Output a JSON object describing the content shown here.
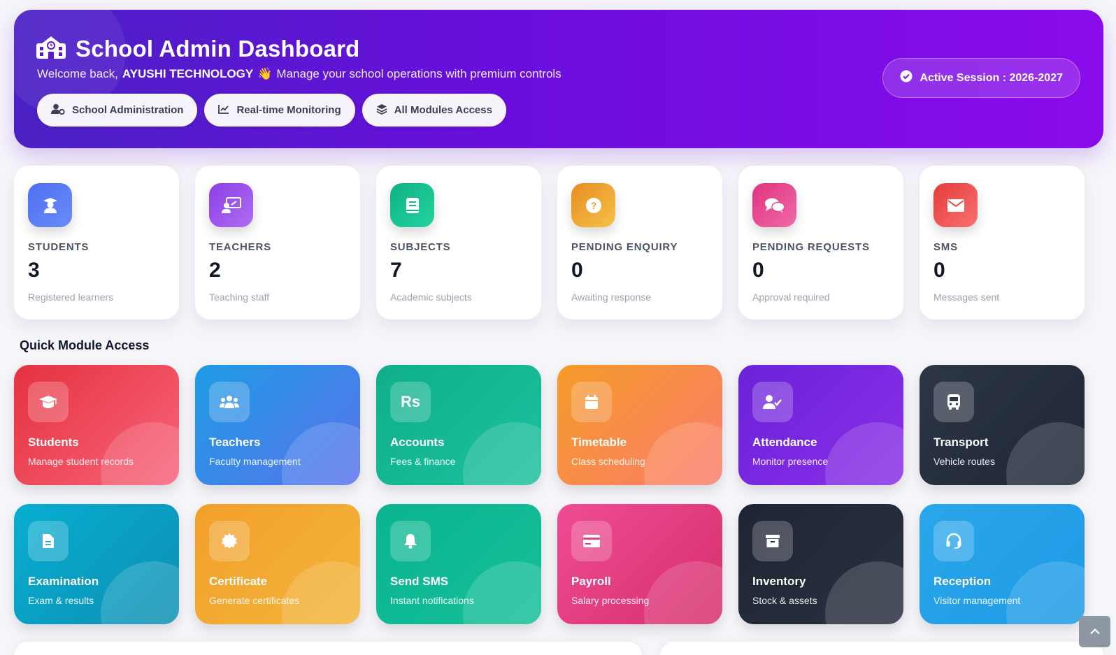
{
  "header": {
    "title": "School Admin Dashboard",
    "welcome_prefix": "Welcome back,",
    "user_name": "AYUSHI TECHNOLOGY",
    "wave_emoji": "👋",
    "welcome_suffix": "Manage your school operations with premium controls",
    "pills": [
      {
        "label": "School Administration",
        "icon": "user-gear-icon"
      },
      {
        "label": "Real-time Monitoring",
        "icon": "chart-line-icon"
      },
      {
        "label": "All Modules Access",
        "icon": "layers-icon"
      }
    ],
    "session_label": "Active Session : 2026-2027"
  },
  "stats": [
    {
      "label": "STUDENTS",
      "value": "3",
      "desc": "Registered learners",
      "icon": "graduate-icon",
      "color": "#4f6ef2"
    },
    {
      "label": "TEACHERS",
      "value": "2",
      "desc": "Teaching staff",
      "icon": "chalkboard-teacher-icon",
      "color": "#8b3fe6"
    },
    {
      "label": "SUBJECTS",
      "value": "7",
      "desc": "Academic subjects",
      "icon": "book-icon",
      "color": "#11b689"
    },
    {
      "label": "PENDING ENQUIRY",
      "value": "0",
      "desc": "Awaiting response",
      "icon": "question-icon",
      "color": "#f0a12b"
    },
    {
      "label": "PENDING REQUESTS",
      "value": "0",
      "desc": "Approval required",
      "icon": "comments-icon",
      "color": "#e64591"
    },
    {
      "label": "SMS",
      "value": "0",
      "desc": "Messages sent",
      "icon": "envelope-icon",
      "color": "#ef4444"
    }
  ],
  "modules_title": "Quick Module Access",
  "modules": [
    {
      "title": "Students",
      "desc": "Manage student records",
      "icon": "graduation-cap-icon"
    },
    {
      "title": "Teachers",
      "desc": "Faculty management",
      "icon": "users-icon"
    },
    {
      "title": "Accounts",
      "desc": "Fees & finance",
      "icon": "rupee-icon",
      "glyph": "Rs"
    },
    {
      "title": "Timetable",
      "desc": "Class scheduling",
      "icon": "calendar-icon"
    },
    {
      "title": "Attendance",
      "desc": "Monitor presence",
      "icon": "user-check-icon"
    },
    {
      "title": "Transport",
      "desc": "Vehicle routes",
      "icon": "bus-icon"
    },
    {
      "title": "Examination",
      "desc": "Exam & results",
      "icon": "file-icon"
    },
    {
      "title": "Certificate",
      "desc": "Generate certificates",
      "icon": "certificate-icon"
    },
    {
      "title": "Send SMS",
      "desc": "Instant notifications",
      "icon": "bell-icon"
    },
    {
      "title": "Payroll",
      "desc": "Salary processing",
      "icon": "credit-card-icon"
    },
    {
      "title": "Inventory",
      "desc": "Stock & assets",
      "icon": "box-icon"
    },
    {
      "title": "Reception",
      "desc": "Visitor management",
      "icon": "headset-icon"
    }
  ],
  "scroll_top_icon": "chevron-up-icon"
}
